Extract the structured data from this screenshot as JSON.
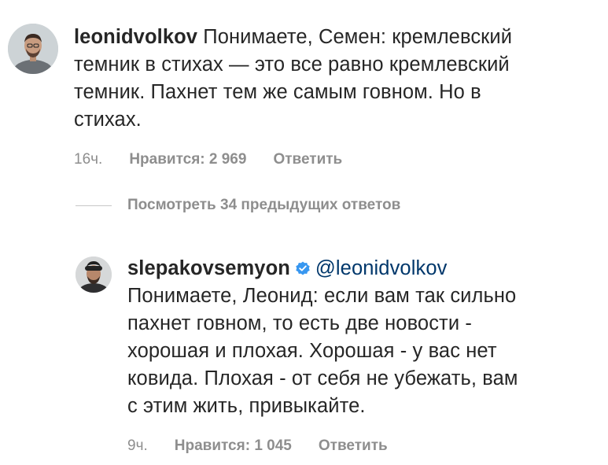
{
  "comment1": {
    "username": "leonidvolkov",
    "text_line1": "Понимаете, Семен: кремлевский",
    "text_line2": "темник в стихах — это все равно кремлевский",
    "text_line3": "темник. Пахнет тем же самым говном. Но в",
    "text_line4": "стихах.",
    "time": "16ч.",
    "likes": "Нравится: 2 969",
    "reply": "Ответить"
  },
  "view_replies": "Посмотреть 34 предыдущих ответов",
  "comment2": {
    "username": "slepakovsemyon",
    "mention": "@leonidvolkov",
    "text_line1": "Понимаете, Леонид: если вам так сильно",
    "text_line2": "пахнет говном, то есть две новости -",
    "text_line3": "хорошая и плохая. Хорошая - у вас нет",
    "text_line4": "ковида. Плохая - от себя не убежать, вам",
    "text_line5": "с этим жить, привыкайте.",
    "time": "9ч.",
    "likes": "Нравится: 1 045",
    "reply": "Ответить"
  },
  "colors": {
    "text": "#262626",
    "muted": "#8e8e8e",
    "mention": "#00376b",
    "verified": "#3897f0"
  },
  "icons": {
    "verified": "verified-badge-icon"
  }
}
